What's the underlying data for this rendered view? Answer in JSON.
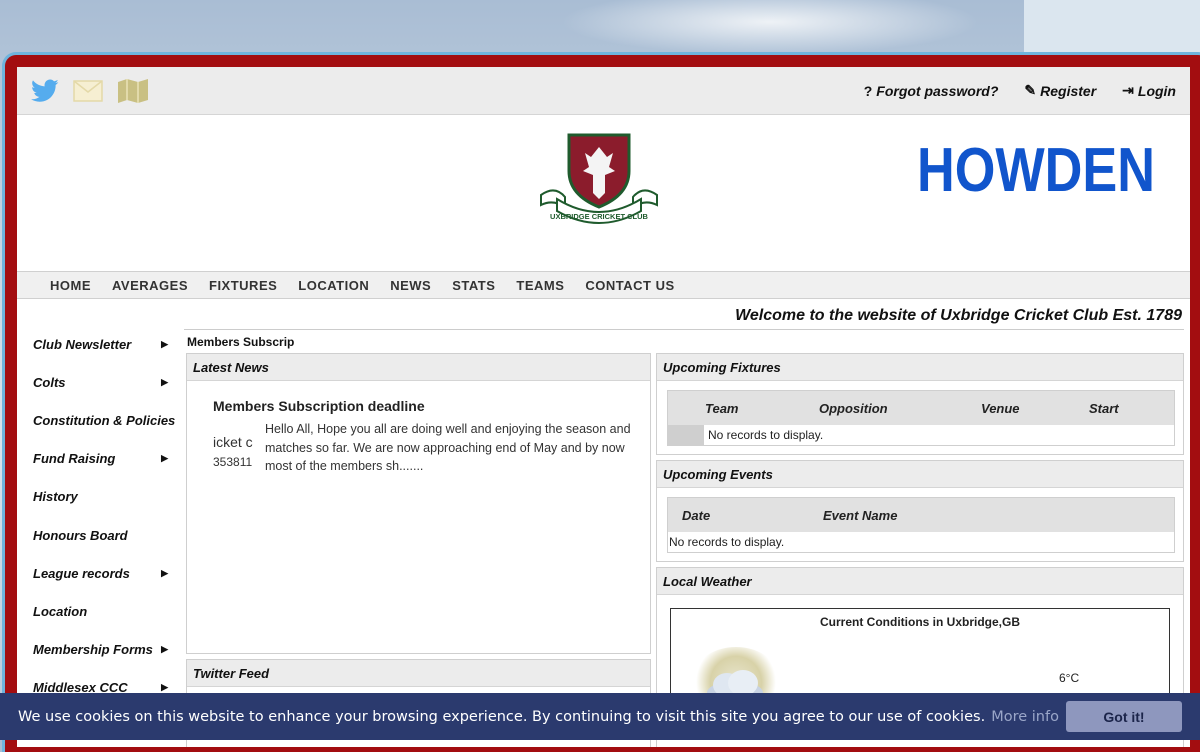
{
  "account": {
    "forgot": "Forgot password?",
    "register": "Register",
    "login": "Login"
  },
  "crest": {
    "text": "UXBRIDGE CRICKET CLUB"
  },
  "sponsor": {
    "text": "HOWDEN",
    "color": "#1155cc"
  },
  "nav": [
    "HOME",
    "AVERAGES",
    "FIXTURES",
    "LOCATION",
    "NEWS",
    "STATS",
    "TEAMS",
    "CONTACT US"
  ],
  "welcome": "Welcome to the website of Uxbridge Cricket Club Est. 1789",
  "sidebar": [
    {
      "label": "Club Newsletter"
    },
    {
      "label": "Colts"
    },
    {
      "label": "Constitution & Policies"
    },
    {
      "label": "Fund Raising"
    },
    {
      "label": "History"
    },
    {
      "label": "Honours Board"
    },
    {
      "label": "League records"
    },
    {
      "label": "Location"
    },
    {
      "label": "Membership Forms"
    },
    {
      "label": "Middlesex CCC"
    }
  ],
  "ticker": "Members Subscrip",
  "latest_news": {
    "heading": "Latest News",
    "title": "Members Subscription deadline",
    "thumb_line1": "icket c",
    "thumb_line2": "353811",
    "text": "Hello All, Hope you all are doing well and enjoying the season and matches so far. We are now approaching end of May and by now most of the members sh......."
  },
  "twitter": {
    "heading": "Twitter Feed"
  },
  "fixtures": {
    "heading": "Upcoming Fixtures",
    "columns": [
      "Team",
      "Opposition",
      "Venue",
      "Start"
    ],
    "empty": "No records to display."
  },
  "events": {
    "heading": "Upcoming Events",
    "columns": [
      "Date",
      "Event Name"
    ],
    "empty": "No records to display."
  },
  "weather": {
    "heading": "Local Weather",
    "title": "Current Conditions in Uxbridge,GB",
    "temp": "6°C"
  },
  "cookie": {
    "text": "We use cookies on this website to enhance your browsing experience. By continuing to visit this site you agree to our use of cookies.",
    "more": "More info",
    "button": "Got it!"
  },
  "colors": {
    "frame": "#a30d10",
    "twitter": "#55acee",
    "cookie_bar": "#2b3a6e"
  }
}
